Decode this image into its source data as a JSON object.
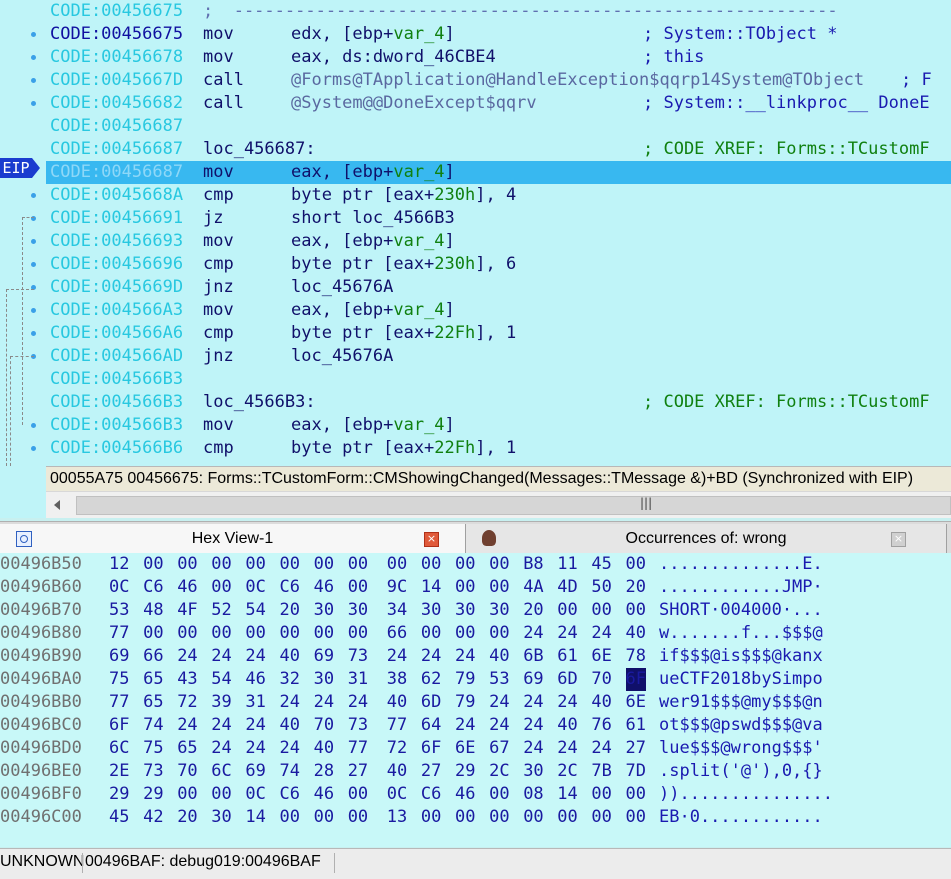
{
  "disassembly": {
    "eip_label": "EIP",
    "lines": [
      {
        "addr": "CODE:00456675",
        "kind": "sep",
        "text": ";  -----------------------------------------------------------"
      },
      {
        "addr": "CODE:00456675",
        "kind": "ins",
        "mn": "mov",
        "op": "edx, [ebp+",
        "opvar": "var_4",
        "opend": "]",
        "cm": "; System::TObject *",
        "main": true
      },
      {
        "addr": "CODE:00456678",
        "kind": "ins",
        "mn": "mov",
        "op": "eax, ds:dword_46CBE4",
        "opvar": "",
        "opend": "",
        "cm": "; this"
      },
      {
        "addr": "CODE:0045667D",
        "kind": "ins",
        "mn": "call",
        "op": "",
        "opvar": "@Forms@TApplication@HandleException$qqrp14System@TObject",
        "opend": "",
        "cm": "; F",
        "callcm": true
      },
      {
        "addr": "CODE:00456682",
        "kind": "ins",
        "mn": "call",
        "op": "",
        "opvar": "@System@@DoneExcept$qqrv",
        "opend": "",
        "cm": "; System::__linkproc__ DoneE"
      },
      {
        "addr": "CODE:00456687",
        "kind": "blank"
      },
      {
        "addr": "CODE:00456687",
        "kind": "label",
        "label": "loc_456687:",
        "xref": "; CODE XREF: Forms::TCustomF"
      },
      {
        "addr": "CODE:00456687",
        "kind": "ins",
        "mn": "mov",
        "op": "eax, [ebp+",
        "opvar": "var_4",
        "opend": "]",
        "cm": "",
        "hl": true
      },
      {
        "addr": "CODE:0045668A",
        "kind": "ins",
        "mn": "cmp",
        "op": "byte ptr [eax+",
        "opvar": "230h",
        "opend": "], 4",
        "cm": "",
        "green": true
      },
      {
        "addr": "CODE:00456691",
        "kind": "ins",
        "mn": "jz",
        "op": "short loc_4566B3",
        "opvar": "",
        "opend": "",
        "cm": ""
      },
      {
        "addr": "CODE:00456693",
        "kind": "ins",
        "mn": "mov",
        "op": "eax, [ebp+",
        "opvar": "var_4",
        "opend": "]",
        "cm": ""
      },
      {
        "addr": "CODE:00456696",
        "kind": "ins",
        "mn": "cmp",
        "op": "byte ptr [eax+",
        "opvar": "230h",
        "opend": "], 6",
        "cm": "",
        "green": true
      },
      {
        "addr": "CODE:0045669D",
        "kind": "ins",
        "mn": "jnz",
        "op": "loc_45676A",
        "opvar": "",
        "opend": "",
        "cm": ""
      },
      {
        "addr": "CODE:004566A3",
        "kind": "ins",
        "mn": "mov",
        "op": "eax, [ebp+",
        "opvar": "var_4",
        "opend": "]",
        "cm": ""
      },
      {
        "addr": "CODE:004566A6",
        "kind": "ins",
        "mn": "cmp",
        "op": "byte ptr [eax+",
        "opvar": "22Fh",
        "opend": "], 1",
        "cm": "",
        "green": true
      },
      {
        "addr": "CODE:004566AD",
        "kind": "ins",
        "mn": "jnz",
        "op": "loc_45676A",
        "opvar": "",
        "opend": "",
        "cm": ""
      },
      {
        "addr": "CODE:004566B3",
        "kind": "blank"
      },
      {
        "addr": "CODE:004566B3",
        "kind": "label",
        "label": "loc_4566B3:",
        "xref": "; CODE XREF: Forms::TCustomF"
      },
      {
        "addr": "CODE:004566B3",
        "kind": "ins",
        "mn": "mov",
        "op": "eax, [ebp+",
        "opvar": "var_4",
        "opend": "]",
        "cm": ""
      },
      {
        "addr": "CODE:004566B6",
        "kind": "ins",
        "mn": "cmp",
        "op": "byte ptr [eax+",
        "opvar": "22Fh",
        "opend": "], 1",
        "cm": "",
        "green": true
      }
    ],
    "status_line": "00055A75 00456675: Forms::TCustomForm::CMShowingChanged(Messages::TMessage &)+BD (Synchronized with EIP)",
    "scroll_grip": "|||"
  },
  "tabs": {
    "hex_label": "Hex View-1",
    "hex_close": "×",
    "occ_label": "Occurrences of: wrong",
    "occ_close": "×"
  },
  "hex": {
    "selected_row": 5,
    "selected_col": 15,
    "rows": [
      {
        "addr": "00496B50",
        "bytes": [
          "12",
          "00",
          "00",
          "00",
          "00",
          "00",
          "00",
          "00",
          "00",
          "00",
          "00",
          "00",
          "B8",
          "11",
          "45",
          "00"
        ],
        "ascii": "..............E."
      },
      {
        "addr": "00496B60",
        "bytes": [
          "0C",
          "C6",
          "46",
          "00",
          "0C",
          "C6",
          "46",
          "00",
          "9C",
          "14",
          "00",
          "00",
          "4A",
          "4D",
          "50",
          "20"
        ],
        "ascii": "............JMP·"
      },
      {
        "addr": "00496B70",
        "bytes": [
          "53",
          "48",
          "4F",
          "52",
          "54",
          "20",
          "30",
          "30",
          "34",
          "30",
          "30",
          "30",
          "20",
          "00",
          "00",
          "00"
        ],
        "ascii": "SHORT·004000·..."
      },
      {
        "addr": "00496B80",
        "bytes": [
          "77",
          "00",
          "00",
          "00",
          "00",
          "00",
          "00",
          "00",
          "66",
          "00",
          "00",
          "00",
          "24",
          "24",
          "24",
          "40"
        ],
        "ascii": "w.......f...$$$@"
      },
      {
        "addr": "00496B90",
        "bytes": [
          "69",
          "66",
          "24",
          "24",
          "24",
          "40",
          "69",
          "73",
          "24",
          "24",
          "24",
          "40",
          "6B",
          "61",
          "6E",
          "78"
        ],
        "ascii": "if$$$@is$$$@kanx"
      },
      {
        "addr": "00496BA0",
        "bytes": [
          "75",
          "65",
          "43",
          "54",
          "46",
          "32",
          "30",
          "31",
          "38",
          "62",
          "79",
          "53",
          "69",
          "6D",
          "70",
          "6F"
        ],
        "ascii": "ueCTF2018bySimpo"
      },
      {
        "addr": "00496BB0",
        "bytes": [
          "77",
          "65",
          "72",
          "39",
          "31",
          "24",
          "24",
          "24",
          "40",
          "6D",
          "79",
          "24",
          "24",
          "24",
          "40",
          "6E"
        ],
        "ascii": "wer91$$$@my$$$@n"
      },
      {
        "addr": "00496BC0",
        "bytes": [
          "6F",
          "74",
          "24",
          "24",
          "24",
          "40",
          "70",
          "73",
          "77",
          "64",
          "24",
          "24",
          "24",
          "40",
          "76",
          "61"
        ],
        "ascii": "ot$$$@pswd$$$@va"
      },
      {
        "addr": "00496BD0",
        "bytes": [
          "6C",
          "75",
          "65",
          "24",
          "24",
          "24",
          "40",
          "77",
          "72",
          "6F",
          "6E",
          "67",
          "24",
          "24",
          "24",
          "27"
        ],
        "ascii": "lue$$$@wrong$$$'"
      },
      {
        "addr": "00496BE0",
        "bytes": [
          "2E",
          "73",
          "70",
          "6C",
          "69",
          "74",
          "28",
          "27",
          "40",
          "27",
          "29",
          "2C",
          "30",
          "2C",
          "7B",
          "7D"
        ],
        "ascii": ".split('@'),0,{}"
      },
      {
        "addr": "00496BF0",
        "bytes": [
          "29",
          "29",
          "00",
          "00",
          "0C",
          "C6",
          "46",
          "00",
          "0C",
          "C6",
          "46",
          "00",
          "08",
          "14",
          "00",
          "00"
        ],
        "ascii": "))..............."
      },
      {
        "addr": "00496C00",
        "bytes": [
          "45",
          "42",
          "20",
          "30",
          "14",
          "00",
          "00",
          "00",
          "13",
          "00",
          "00",
          "00",
          "00",
          "00",
          "00",
          "00"
        ],
        "ascii": "EB·0............"
      }
    ]
  },
  "bottom_status": {
    "mode": "UNKNOWN",
    "location": "00496BAF: debug019:00496BAF"
  },
  "colors": {
    "disasm_bg": "#bff4f8",
    "highlight": "#38b8f0",
    "hex_bg": "#c8f8f8",
    "eip_badge": "#1a3ccf"
  }
}
